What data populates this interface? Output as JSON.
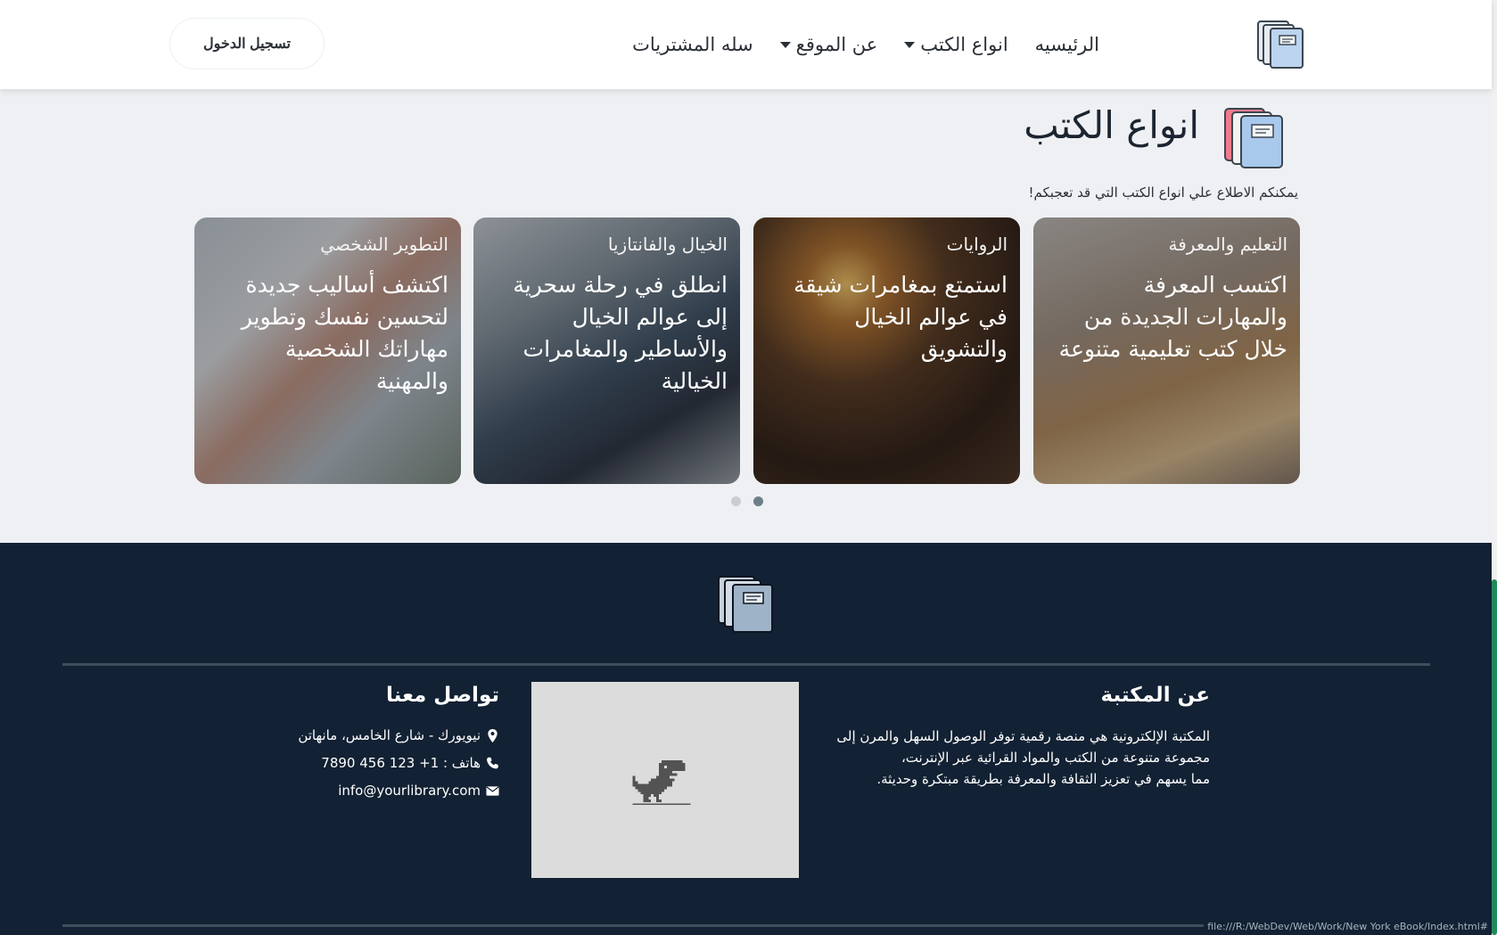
{
  "nav": {
    "items": [
      {
        "label": "الرئيسيه",
        "dropdown": false
      },
      {
        "label": "انواع الكتب",
        "dropdown": true
      },
      {
        "label": "عن الموقع",
        "dropdown": true
      },
      {
        "label": "سله المشتريات",
        "dropdown": false
      }
    ],
    "login_label": "تسجيل الدخول",
    "logo_icon": "books-icon"
  },
  "section": {
    "title": "انواع الكتب",
    "subtitle": "يمكنكم الاطلاع علي انواع الكتب التي قد تعجبكم!",
    "icon": "books-color-icon"
  },
  "cards": [
    {
      "category": "التعليم والمعرفة",
      "description": "اكتسب المعرفة والمهارات الجديدة من خلال كتب تعليمية متنوعة"
    },
    {
      "category": "الروايات",
      "description": "استمتع بمغامرات شيقة في عوالم الخيال والتشويق"
    },
    {
      "category": "الخيال والفانتازيا",
      "description": "انطلق في رحلة سحرية إلى عوالم الخيال والأساطير والمغامرات الخيالية"
    },
    {
      "category": "التطوير الشخصي",
      "description": "اكتشف أساليب جديدة لتحسين نفسك وتطوير مهاراتك الشخصية والمهنية"
    }
  ],
  "carousel": {
    "page_count": 2,
    "active_page": 1
  },
  "footer": {
    "about_title": "عن المكتبة",
    "about_lines": [
      "المكتبة الإلكترونية هي منصة رقمية توفر الوصول السهل والمرن إلى",
      "مجموعة متنوعة من الكتب والمواد القرائية عبر الإنترنت،",
      "مما يسهم في تعزيز الثقافة والمعرفة بطريقة مبتكرة وحديثة."
    ],
    "contact_title": "تواصل معنا",
    "contacts": [
      {
        "icon": "map-marker-icon",
        "text": "نيويورك - شارع الخامس، مانهاتن"
      },
      {
        "icon": "phone-icon",
        "text": "هاتف : 1+ 123 456 7890"
      },
      {
        "icon": "envelope-icon",
        "text": "info@yourlibrary.com"
      }
    ],
    "map_placeholder_icon": "offline-dino-icon"
  },
  "status_bar": {
    "url": "file:///R:/WebDev/Web/Work/New York eBook/Index.html#"
  },
  "colors": {
    "footer_bg": "#122133",
    "page_bg": "#eef0f3",
    "active_dot": "#6d7f8b",
    "scroll_thumb": "#1f8a5a"
  }
}
